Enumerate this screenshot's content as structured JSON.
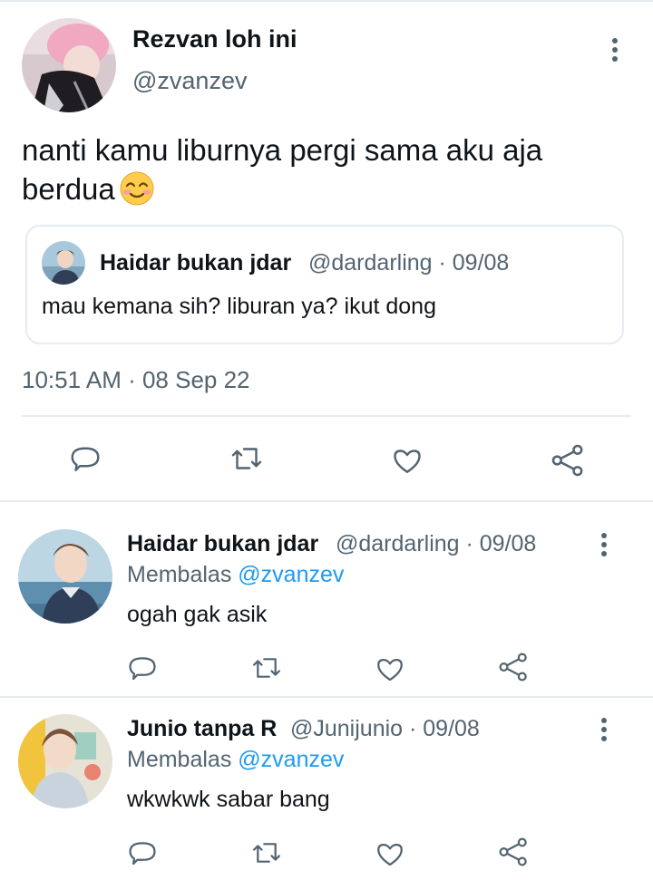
{
  "main_tweet": {
    "display_name": "Rezvan loh ini",
    "handle": "@zvanzev",
    "text": "nanti kamu liburnya pergi sama aku aja berdua",
    "emoji": "smiling-face-with-smiling-eyes",
    "timestamp": "10:51 AM · 08 Sep 22",
    "quoted": {
      "display_name": "Haidar bukan jdar",
      "meta": "@dardarling · 09/08",
      "text": "mau kemana sih? liburan ya? ikut dong"
    },
    "actions": [
      "reply-icon",
      "retweet-icon",
      "like-icon",
      "share-icon"
    ]
  },
  "replies": [
    {
      "display_name": "Haidar bukan jdar",
      "meta": "@dardarling · 09/08",
      "replying_prefix": "Membalas",
      "replying_to": "@zvanzev",
      "text": "ogah gak asik"
    },
    {
      "display_name": "Junio tanpa R",
      "meta": "@Junijunio · 09/08",
      "replying_prefix": "Membalas",
      "replying_to": "@zvanzev",
      "text": "wkwkwk sabar bang"
    }
  ],
  "colors": {
    "text": "#0f1419",
    "secondary": "#536471",
    "accent": "#1d9bf0",
    "divider": "#e6ecf0"
  }
}
